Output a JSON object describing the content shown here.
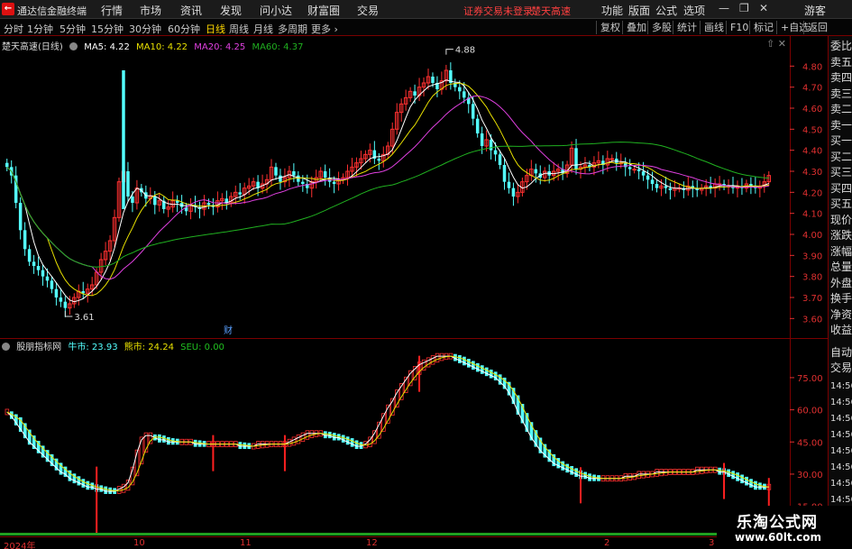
{
  "titlebar": {
    "app_name": "通达信金融终端",
    "menus": [
      "行情",
      "市场",
      "资讯",
      "发现",
      "问小达",
      "财富圈",
      "交易"
    ],
    "warning": "证券交易未登录",
    "stock_name": "楚天高速",
    "right_menus": [
      "功能",
      "版面",
      "公式",
      "选项"
    ],
    "user": "游客"
  },
  "toolbar": {
    "periods": [
      "分时",
      "1分钟",
      "5分钟",
      "15分钟",
      "30分钟",
      "60分钟",
      "日线",
      "周线",
      "月线",
      "多周期",
      "更多"
    ],
    "active_period": "日线",
    "buttons": [
      "复权",
      "叠加",
      "多股",
      "统计",
      "画线",
      "F10",
      "标记",
      "+自选",
      "返回"
    ]
  },
  "main_legend": {
    "stock": "楚天高速(日线)",
    "ma5": "MA5: 4.22",
    "ma10": "MA10: 4.22",
    "ma20": "MA20: 4.25",
    "ma60": "MA60: 4.37"
  },
  "sub_legend": {
    "name": "股朋指标网",
    "bull": "牛市: 23.93",
    "bear": "熊市: 24.24",
    "seu": "SEU: 0.00"
  },
  "colors": {
    "ma5": "#ffffff",
    "ma10": "#e8e000",
    "ma20": "#e040e0",
    "ma60": "#20b020",
    "up": "#ff3030",
    "down": "#54ffff",
    "axis": "#e03030"
  },
  "price_axis": [
    "4.80",
    "4.70",
    "4.60",
    "4.50",
    "4.40",
    "4.30",
    "4.20",
    "4.10",
    "4.00",
    "3.90",
    "3.80",
    "3.70",
    "3.60"
  ],
  "price_annotations": {
    "high": "4.88",
    "low": "3.61",
    "marker": "财"
  },
  "sub_axis": [
    "75.00",
    "60.00",
    "45.00",
    "30.00",
    "15.00"
  ],
  "x_axis": [
    "2024年",
    "10",
    "11",
    "12",
    "2",
    "3"
  ],
  "right_panel": {
    "quote_items": [
      "委比",
      "卖五",
      "卖四",
      "卖三",
      "卖二",
      "卖一",
      "买一",
      "买二",
      "买三",
      "买四",
      "买五",
      "现价",
      "涨跌",
      "涨幅",
      "总量",
      "外盘",
      "换手",
      "净资",
      "收益"
    ],
    "trade_items": [
      "自动",
      "交易"
    ],
    "times": [
      "14:56",
      "14:56",
      "14:56",
      "14:56",
      "14:56",
      "14:56",
      "14:56",
      "14:56",
      "14:56",
      "14:56"
    ]
  },
  "watermark": {
    "line1": "乐淘公式网",
    "line2": "www.60lt.com"
  },
  "chart_data": [
    {
      "type": "candlestick",
      "title": "楚天高速(日线)",
      "ylim": [
        3.55,
        4.9
      ],
      "x": [
        0,
        1,
        2,
        3,
        4,
        5,
        6,
        7,
        8,
        9,
        10,
        11,
        12,
        13,
        14,
        15,
        16,
        17,
        18,
        19,
        20,
        21,
        22,
        23,
        24,
        25,
        26,
        27,
        28,
        29,
        30,
        31,
        32,
        33,
        34,
        35,
        36,
        37,
        38,
        39,
        40,
        41,
        42,
        43,
        44,
        45,
        46,
        47,
        48,
        49,
        50,
        51,
        52,
        53,
        54,
        55,
        56,
        57,
        58,
        59,
        60,
        61,
        62,
        63,
        64,
        65,
        66,
        67,
        68,
        69,
        70,
        71,
        72,
        73,
        74,
        75,
        76,
        77,
        78,
        79,
        80,
        81,
        82,
        83,
        84,
        85,
        86,
        87,
        88,
        89,
        90,
        91,
        92,
        93,
        94,
        95,
        96,
        97,
        98,
        99,
        100,
        101,
        102,
        103,
        104,
        105,
        106,
        107,
        108,
        109,
        110,
        111,
        112,
        113,
        114,
        115,
        116,
        117,
        118,
        119,
        120,
        121,
        122,
        123,
        124,
        125,
        126,
        127,
        128,
        129,
        130,
        131,
        132,
        133,
        134,
        135,
        136,
        137,
        138,
        139,
        140,
        141,
        142,
        143,
        144,
        145,
        146,
        147,
        148,
        149,
        150,
        151,
        152,
        153,
        154,
        155,
        156,
        157,
        158,
        159,
        160,
        161,
        162,
        163,
        164,
        165,
        166,
        167,
        168,
        169,
        170
      ],
      "close": [
        4.32,
        4.28,
        4.15,
        4.02,
        3.93,
        3.87,
        3.85,
        3.83,
        3.8,
        3.78,
        3.74,
        3.7,
        3.68,
        3.65,
        3.67,
        3.7,
        3.73,
        3.72,
        3.74,
        3.76,
        3.82,
        3.88,
        3.92,
        3.97,
        4.08,
        4.25,
        4.3,
        4.18,
        4.15,
        4.22,
        4.2,
        4.17,
        4.18,
        4.14,
        4.16,
        4.12,
        4.13,
        4.16,
        4.15,
        4.13,
        4.11,
        4.14,
        4.13,
        4.12,
        4.15,
        4.14,
        4.13,
        4.16,
        4.17,
        4.15,
        4.18,
        4.2,
        4.19,
        4.22,
        4.23,
        4.25,
        4.22,
        4.24,
        4.26,
        4.32,
        4.28,
        4.25,
        4.27,
        4.3,
        4.28,
        4.25,
        4.24,
        4.22,
        4.25,
        4.27,
        4.3,
        4.27,
        4.25,
        4.24,
        4.26,
        4.27,
        4.3,
        4.32,
        4.34,
        4.36,
        4.38,
        4.4,
        4.36,
        4.35,
        4.38,
        4.42,
        4.5,
        4.58,
        4.62,
        4.65,
        4.68,
        4.66,
        4.7,
        4.72,
        4.75,
        4.72,
        4.69,
        4.73,
        4.78,
        4.72,
        4.7,
        4.68,
        4.65,
        4.62,
        4.55,
        4.48,
        4.42,
        4.45,
        4.4,
        4.38,
        4.33,
        4.25,
        4.22,
        4.18,
        4.2,
        4.25,
        4.28,
        4.31,
        4.29,
        4.27,
        4.3,
        4.28,
        4.3,
        4.31,
        4.29,
        4.33,
        4.41,
        4.31,
        4.32,
        4.33,
        4.32,
        4.34,
        4.35,
        4.33,
        4.36,
        4.36,
        4.34,
        4.34,
        4.32,
        4.31,
        4.31,
        4.3,
        4.28,
        4.26,
        4.24,
        4.22,
        4.23,
        4.22,
        4.21,
        4.22,
        4.22,
        4.21,
        4.23,
        4.22,
        4.21,
        4.22,
        4.23,
        4.22,
        4.24,
        4.24,
        4.23,
        4.23,
        4.22,
        4.23,
        4.22,
        4.24,
        4.23,
        4.22,
        4.23,
        4.25,
        4.28
      ],
      "series": [
        {
          "name": "MA5",
          "values": "ma5"
        },
        {
          "name": "MA10",
          "values": "ma10"
        },
        {
          "name": "MA20",
          "values": "ma20"
        },
        {
          "name": "MA60",
          "values": "ma60"
        }
      ]
    },
    {
      "type": "bar",
      "title": "股朋指标网",
      "ylim": [
        14,
        88
      ],
      "series": [
        {
          "name": "牛市"
        },
        {
          "name": "熊市"
        },
        {
          "name": "SEU"
        }
      ],
      "bull": [
        59,
        57,
        54,
        51,
        48,
        45,
        43,
        41,
        39,
        37,
        35,
        33,
        31,
        30,
        28,
        27,
        26,
        25,
        24,
        24,
        23,
        23,
        22,
        22,
        22,
        23,
        24,
        26,
        32,
        40,
        46,
        48,
        48,
        47,
        46,
        46,
        45,
        45,
        45,
        45,
        45,
        45,
        44,
        44,
        44,
        44,
        44,
        44,
        44,
        44,
        44,
        44,
        43,
        43,
        43,
        43,
        44,
        44,
        44,
        44,
        44,
        44,
        44,
        45,
        46,
        47,
        48,
        49,
        49,
        49,
        49,
        48,
        48,
        47,
        47,
        46,
        45,
        44,
        43,
        43,
        44,
        46,
        49,
        53,
        57,
        61,
        64,
        68,
        71,
        74,
        77,
        79,
        81,
        82,
        83,
        84,
        85,
        85,
        85,
        85,
        84,
        83,
        82,
        81,
        80,
        79,
        78,
        77,
        76,
        75,
        73,
        71,
        68,
        64,
        59,
        55,
        51,
        47,
        44,
        41,
        39,
        37,
        35,
        34,
        33,
        32,
        31,
        30,
        29,
        29,
        28,
        28,
        28,
        28,
        28,
        28,
        28,
        28,
        29,
        29,
        29,
        30,
        30,
        30,
        30,
        31,
        31,
        31,
        31,
        31,
        31,
        31,
        31,
        31,
        32,
        32,
        32,
        32,
        32,
        31,
        31,
        30,
        29,
        28,
        27,
        26,
        25,
        24,
        24,
        24,
        24
      ],
      "signals": [
        20,
        46,
        62,
        92,
        128,
        160,
        170
      ]
    }
  ]
}
